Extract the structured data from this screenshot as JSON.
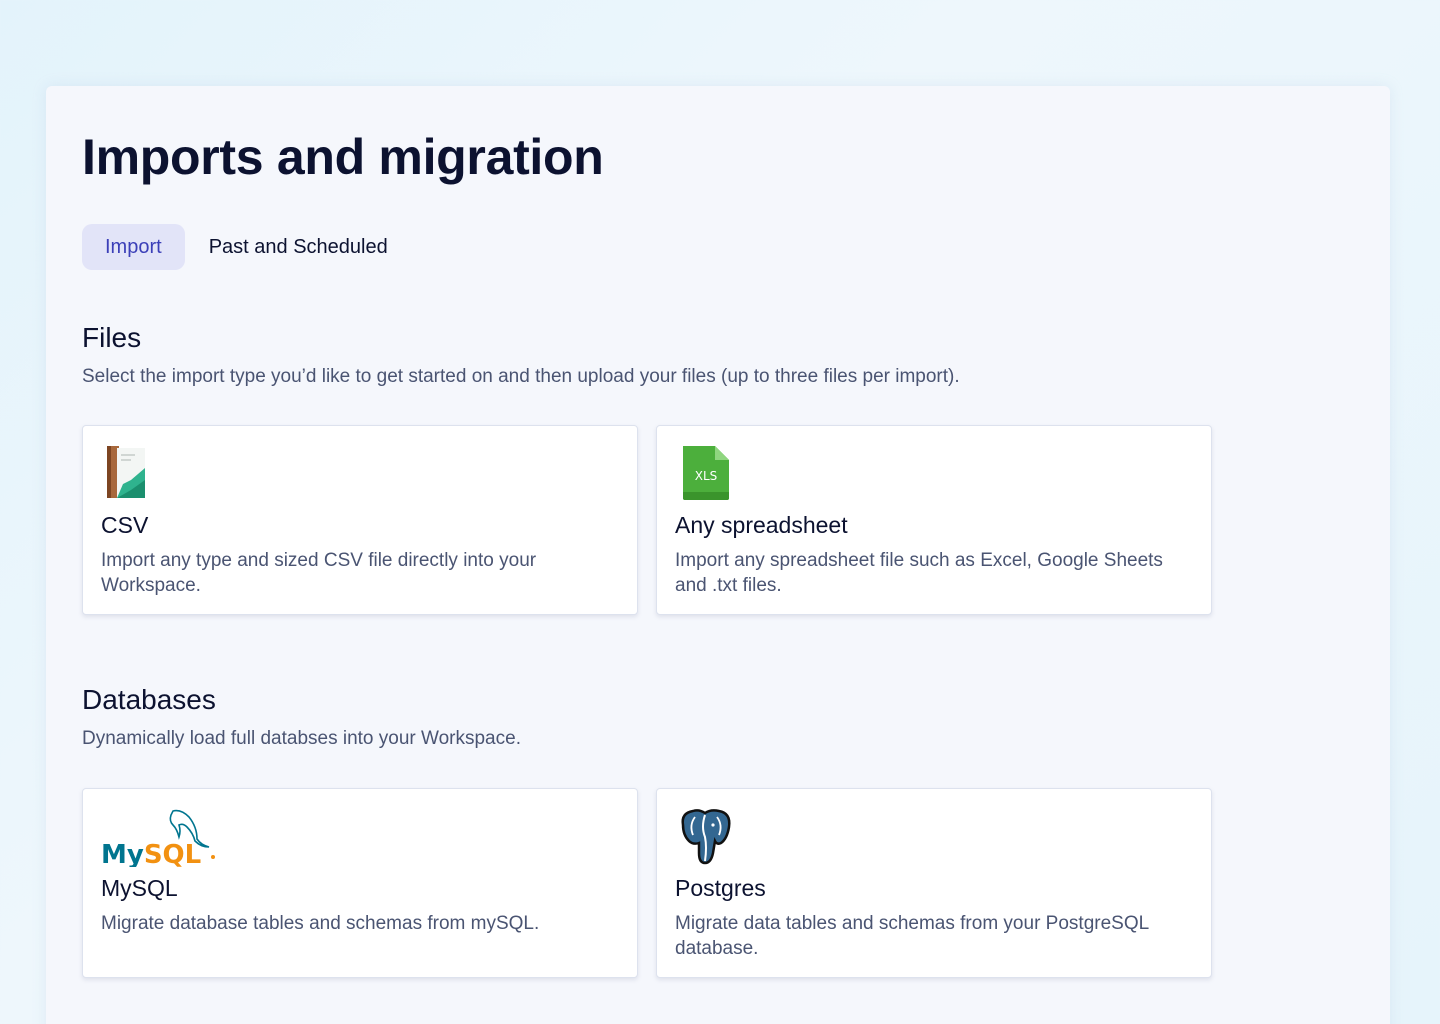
{
  "page": {
    "title": "Imports and migration"
  },
  "tabs": [
    {
      "label": "Import",
      "active": true
    },
    {
      "label": "Past and Scheduled",
      "active": false
    }
  ],
  "files_section": {
    "title": "Files",
    "description": "Select the import type you’d like to get started on and then upload your files (up to three files per import).",
    "cards": [
      {
        "icon": "csv-file-icon",
        "title": "CSV",
        "description": "Import any type and sized CSV file directly into your Workspace."
      },
      {
        "icon": "xls-file-icon",
        "icon_text": "XLS",
        "title": "Any spreadsheet",
        "description": "Import any spreadsheet file such as Excel, Google Sheets and .txt files."
      }
    ]
  },
  "databases_section": {
    "title": "Databases",
    "description": "Dynamically load full databses into your Workspace.",
    "cards": [
      {
        "icon": "mysql-logo-icon",
        "logo_text": "MySQL",
        "title": "MySQL",
        "description": "Migrate database tables and schemas from mySQL."
      },
      {
        "icon": "postgres-elephant-icon",
        "title": "Postgres",
        "description": "Migrate data tables and schemas from your PostgreSQL database."
      }
    ]
  },
  "colors": {
    "active_tab_bg": "#e2e4f8",
    "active_tab_text": "#3b3fb8",
    "heading": "#0c1230",
    "body_text": "#4a5472",
    "xls_green": "#4caf3c",
    "mysql_blue": "#00758f",
    "mysql_orange": "#f29111",
    "postgres_blue": "#336791"
  }
}
